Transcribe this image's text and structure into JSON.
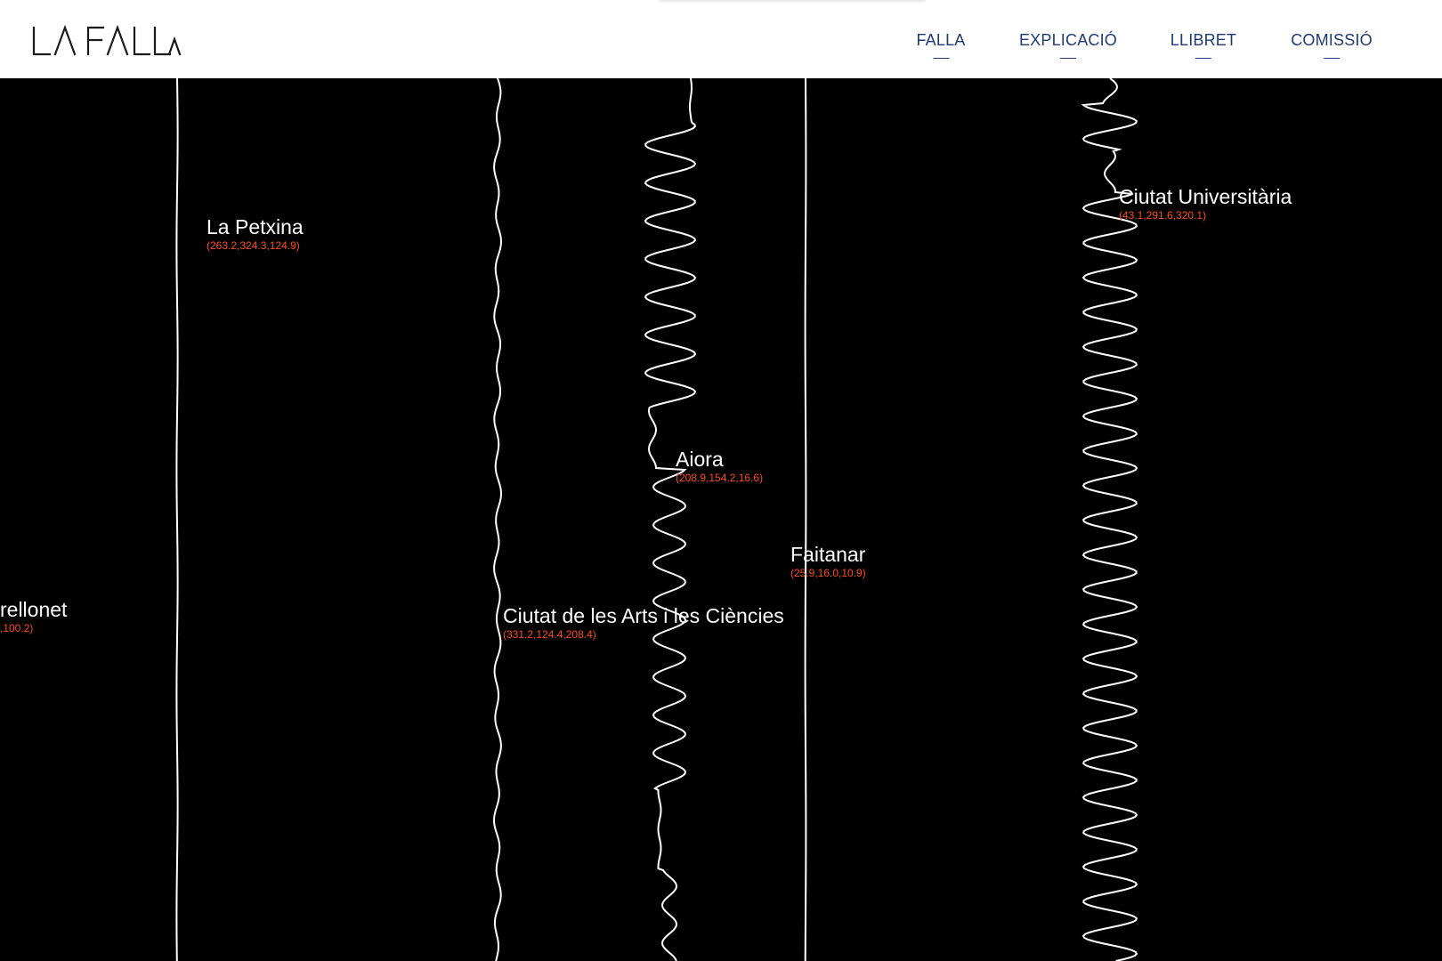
{
  "header": {
    "logo_text": "LA FALLA",
    "nav": [
      {
        "label": "FALLA"
      },
      {
        "label": "EXPLICACIÓ"
      },
      {
        "label": "LLIBRET"
      },
      {
        "label": "COMISSIÓ"
      }
    ]
  },
  "colors": {
    "background": "#000000",
    "header_bg": "#ffffff",
    "nav_text": "#1f3b73",
    "label_text": "#ffffff",
    "coords_text": "#ff4a1a",
    "line": "#ffffff"
  },
  "labels": [
    {
      "name": "La Petxina",
      "coords": "(263.2,324.3,124.9)"
    },
    {
      "name": "Ciutat Universitària",
      "coords": "(43.1,291.6,320.1)"
    },
    {
      "name": "Aiora",
      "coords": "(208.9,154.2,16.6)"
    },
    {
      "name": "Faitanar",
      "coords": "(25.9,16.0,10.9)"
    },
    {
      "name": "Ciutat de les Arts i les Ciències",
      "coords": "(331.2,124.4,208.4)"
    },
    {
      "name": "rellonet",
      "coords": ",100.2)"
    }
  ]
}
